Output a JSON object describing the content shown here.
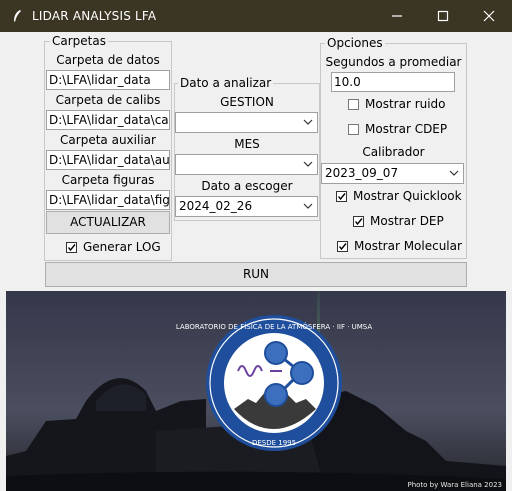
{
  "window": {
    "title": "LIDAR ANALYSIS LFA"
  },
  "carpetas": {
    "frame_label": "Carpetas",
    "datos_label": "Carpeta de datos",
    "datos_value": "D:\\LFA\\lidar_data",
    "calibs_label": "Carpeta de calibs",
    "calibs_value": "D:\\LFA\\lidar_data\\calib",
    "auxiliar_label": "Carpeta auxiliar",
    "auxiliar_value": "D:\\LFA\\lidar_data\\auxs",
    "figuras_label": "Carpeta figuras",
    "figuras_value": "D:\\LFA\\lidar_data\\figs",
    "actualizar_label": "ACTUALIZAR",
    "generar_log_label": "Generar LOG",
    "generar_log_checked": true
  },
  "dato": {
    "frame_label": "Dato a analizar",
    "gestion_label": "GESTION",
    "gestion_value": "",
    "mes_label": "MES",
    "mes_value": "",
    "escoger_label": "Dato a escoger",
    "escoger_value": "2024_02_26"
  },
  "opciones": {
    "frame_label": "Opciones",
    "segundos_label": "Segundos a promediar",
    "segundos_value": "10.0",
    "ruido_label": "Mostrar ruido",
    "ruido_checked": false,
    "cdep_label": "Mostrar CDEP",
    "cdep_checked": false,
    "calibrador_label": "Calibrador",
    "calibrador_value": "2023_09_07",
    "quicklook_label": "Mostrar Quicklook",
    "quicklook_checked": true,
    "dep_label": "Mostrar DEP",
    "dep_checked": true,
    "molecular_label": "Mostrar Molecular",
    "molecular_checked": true
  },
  "run": {
    "label": "RUN"
  },
  "photo": {
    "logo_top_text": "LABORATORIO DE FÍSICA DE LA ATMÓSFERA · IIF · UMSA",
    "logo_bottom_text": "DESDE 1995",
    "credit": "Photo by Wara Eliana 2023"
  },
  "colors": {
    "titlebar": "#3b3624",
    "logo_blue": "#1f4f9c",
    "sky_dark": "#2e3548"
  }
}
